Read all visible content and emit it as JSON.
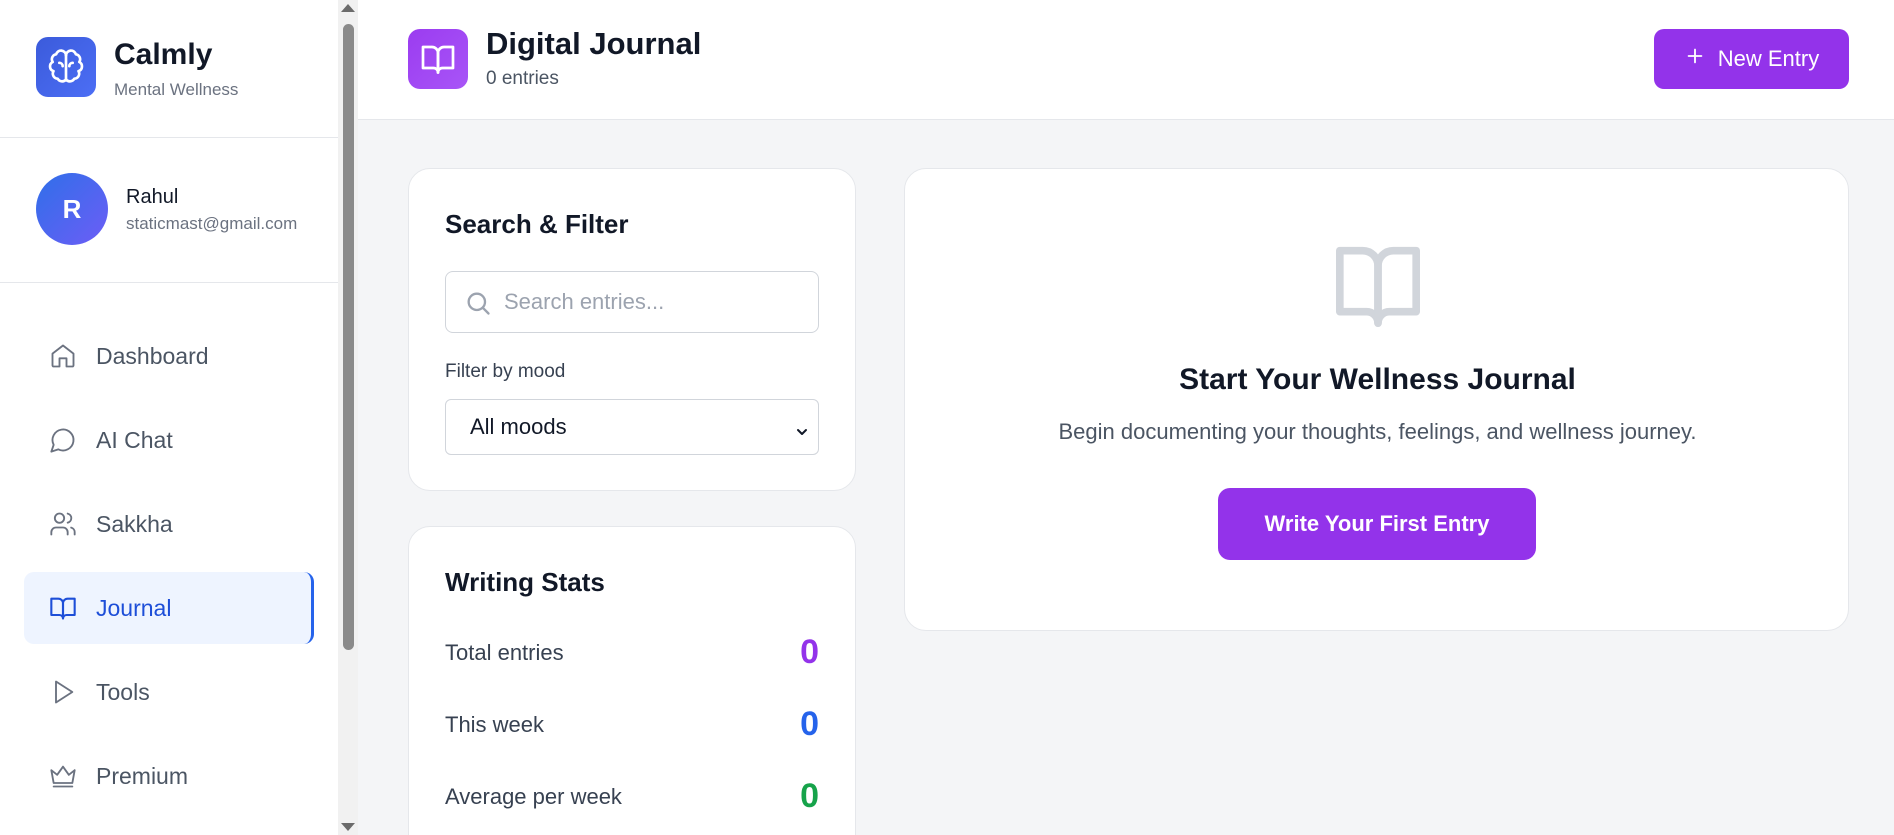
{
  "brand": {
    "name": "Calmly",
    "subtitle": "Mental Wellness"
  },
  "user": {
    "initial": "R",
    "name": "Rahul",
    "email": "staticmast@gmail.com"
  },
  "nav": [
    {
      "label": "Dashboard",
      "icon": "home-icon"
    },
    {
      "label": "AI Chat",
      "icon": "chat-bubble-icon"
    },
    {
      "label": "Sakkha",
      "icon": "users-icon"
    },
    {
      "label": "Journal",
      "icon": "book-open-icon",
      "active": true
    },
    {
      "label": "Tools",
      "icon": "play-icon"
    },
    {
      "label": "Premium",
      "icon": "crown-icon"
    }
  ],
  "header": {
    "title": "Digital Journal",
    "count": "0 entries",
    "new_entry_label": "New Entry"
  },
  "filter": {
    "title": "Search & Filter",
    "search_placeholder": "Search entries...",
    "search_value": "",
    "mood_label": "Filter by mood",
    "mood_selected": "All moods"
  },
  "stats": {
    "title": "Writing Stats",
    "rows": [
      {
        "label": "Total entries",
        "value": "0",
        "color": "#9333ea"
      },
      {
        "label": "This week",
        "value": "0",
        "color": "#2563eb"
      },
      {
        "label": "Average per week",
        "value": "0",
        "color": "#16a34a"
      }
    ]
  },
  "empty": {
    "title": "Start Your Wellness Journal",
    "subtitle": "Begin documenting your thoughts, feelings, and wellness journey.",
    "button_label": "Write Your First Entry"
  },
  "colors": {
    "accent": "#9333ea",
    "primary": "#2563eb",
    "success": "#16a34a"
  }
}
